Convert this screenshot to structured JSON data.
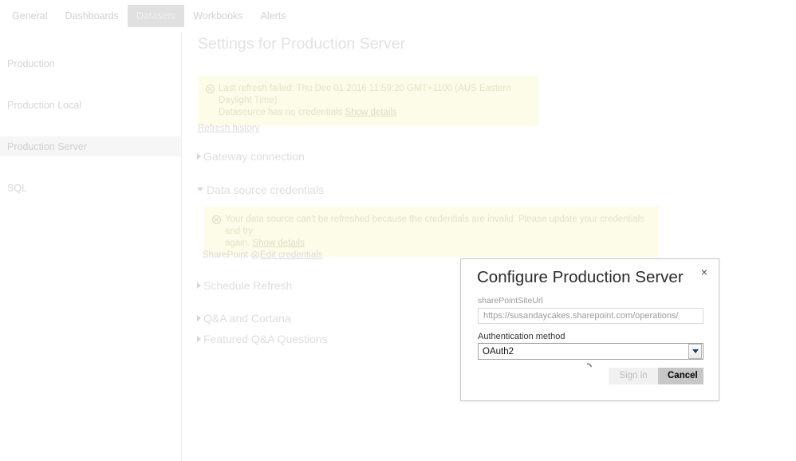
{
  "tabs": [
    {
      "label": "General",
      "active": false
    },
    {
      "label": "Dashboards",
      "active": false
    },
    {
      "label": "Datasets",
      "active": true
    },
    {
      "label": "Workbooks",
      "active": false
    },
    {
      "label": "Alerts",
      "active": false
    }
  ],
  "sidebar": {
    "items": [
      {
        "label": "Production",
        "selected": false
      },
      {
        "label": "Production Local",
        "selected": false
      },
      {
        "label": "Production Server",
        "selected": true
      },
      {
        "label": "SQL",
        "selected": false
      }
    ]
  },
  "main": {
    "page_title": "Settings for Production Server",
    "refresh_banner": {
      "icon": "error-circle-x-icon",
      "line1": "Last refresh failed: Thu Dec 01 2016 11:59:20 GMT+1100 (AUS Eastern Daylight Time)",
      "line2": "Datasource has no credentials",
      "link": "Show details"
    },
    "refresh_history_link": "Refresh history",
    "sections": {
      "gateway": {
        "label": "Gateway connection",
        "expanded": false
      },
      "data_source_credentials": {
        "label": "Data source credentials",
        "expanded": true
      },
      "schedule_refresh": {
        "label": "Schedule Refresh",
        "expanded": false
      },
      "qna_cortana": {
        "label": "Q&A and Cortana",
        "expanded": false
      },
      "featured_qna": {
        "label": "Featured Q&A Questions",
        "expanded": false
      }
    },
    "credentials_banner": {
      "icon": "error-circle-x-icon",
      "line1": "Your data source can't be refreshed because the credentials are invalid. Please update your credentials and try",
      "line2": "again.",
      "link": "Show details"
    },
    "credential_row": {
      "source": "SharePoint",
      "icon": "error-circle-x-icon",
      "edit_link": "Edit credentials"
    }
  },
  "modal": {
    "title": "Configure Production Server",
    "close_label": "×",
    "url_field": {
      "label": "sharePointSiteUrl",
      "value": "https://susandaycakes.sharepoint.com/operations/"
    },
    "auth_field": {
      "label": "Authentication method",
      "value": "OAuth2",
      "options": [
        "OAuth2"
      ]
    },
    "spinner": "loading-spinner-icon",
    "buttons": {
      "signin": "Sign in",
      "cancel": "Cancel"
    }
  },
  "colors": {
    "tab_active_bg": "#e0e0e0",
    "sidebar_selected_bg": "#f6f6f6",
    "banner_bg": "#fdfce8",
    "cancel_button_bg": "#c7c7c7",
    "dropdown_chevron": "#1f3a6e"
  }
}
